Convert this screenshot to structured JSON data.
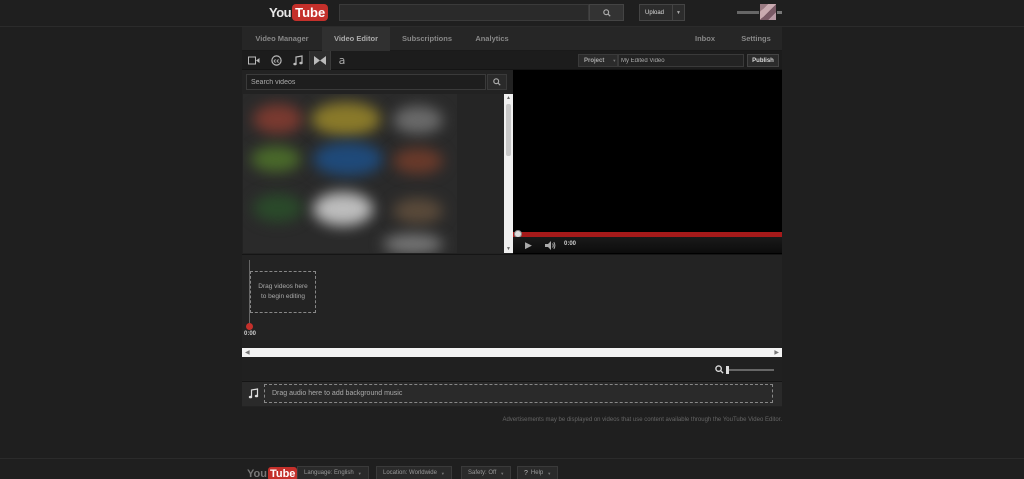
{
  "masthead": {
    "logo_you": "You",
    "logo_tube": "Tube",
    "upload_label": "Upload"
  },
  "nav": {
    "items": [
      {
        "label": "Video Manager"
      },
      {
        "label": "Video Editor"
      },
      {
        "label": "Subscriptions"
      },
      {
        "label": "Analytics"
      },
      {
        "label": "Inbox"
      },
      {
        "label": "Settings"
      }
    ],
    "active": "Video Editor"
  },
  "toolbar": {
    "tools": [
      "video-camera-icon",
      "creative-commons-icon",
      "music-note-icon",
      "transitions-icon",
      "text-icon"
    ],
    "text_tool_glyph": "a",
    "project_label": "Project",
    "project_name": "My Edited Video",
    "publish_label": "Publish"
  },
  "library": {
    "search_placeholder": "Search videos"
  },
  "player": {
    "time": "0:00",
    "progress": 0
  },
  "timeline": {
    "playhead_time": "0:00",
    "drop_video_text": "Drag videos here to begin editing",
    "drop_audio_text": "Drag audio here to add background music"
  },
  "disclaimer": "Advertisements may be displayed on videos that use content available through the YouTube Video Editor.",
  "footer": {
    "language": "Language: English",
    "location": "Location: Worldwide",
    "safety": "Safety: Off",
    "help": "Help"
  },
  "colors": {
    "brand_red": "#c4302b",
    "progress_red": "#a61a1a",
    "background": "#1f1f1f"
  }
}
